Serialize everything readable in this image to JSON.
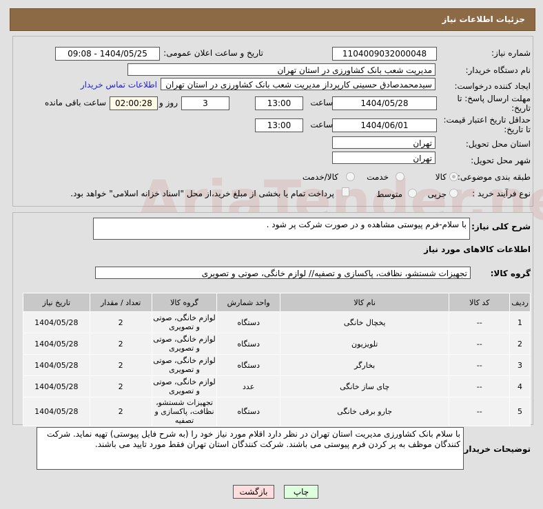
{
  "header": {
    "title": "جزئیات اطلاعات نیاز"
  },
  "form": {
    "need_number_label": "شماره نیاز:",
    "need_number": "1104009032000048",
    "announce_label": "تاریخ و ساعت اعلان عمومی:",
    "announce_value": "1404/05/25 - 09:08",
    "buyer_label": "نام دستگاه خریدار:",
    "buyer": "مدیریت شعب بانک کشاورزی در استان تهران",
    "creator_label": "ایجاد کننده درخواست:",
    "creator": "سیدمحمدصادق حسینی کارپرداز مدیریت شعب بانک کشاورزی در استان تهران",
    "contact_link": "اطلاعات تماس خریدار",
    "deadline_label": "مهلت ارسال پاسخ: تا تاریخ:",
    "deadline_date": "1404/05/28",
    "time_label": "ساعت",
    "deadline_time": "13:00",
    "days": "3",
    "days_label": "روز و",
    "remaining": "02:00:28",
    "remaining_label": "ساعت باقی مانده",
    "validity_label": "حداقل تاریخ اعتبار قیمت: تا تاریخ:",
    "validity_date": "1404/06/01",
    "validity_time": "13:00",
    "province_label": "استان محل تحویل:",
    "province": "تهران",
    "city_label": "شهر محل تحویل:",
    "city": "تهران",
    "category_label": "طبقه بندی موضوعی:",
    "category_options": [
      "کالا",
      "خدمت",
      "کالا/خدمت"
    ],
    "process_label": "نوع فرآیند خرید :",
    "process_options": [
      "جزیی",
      "متوسط"
    ],
    "payment_note": "پرداخت تمام یا بخشی از مبلغ خرید،از محل \"اسناد خزانه اسلامی\" خواهد بود."
  },
  "details": {
    "desc_label": "شرح کلی نیاز:",
    "desc": "با سلام-فرم پیوستی مشاهده و در صورت شرکت پر شود .",
    "goods_title": "اطلاعات کالاهای مورد نیاز",
    "group_label": "گروه کالا:",
    "group": "تجهیزات شستشو، نظافت، پاکسازی و تصفیه// لوازم خانگی، صوتی و تصویری",
    "columns": [
      "ردیف",
      "کد کالا",
      "نام کالا",
      "واحد شمارش",
      "گروه کالا",
      "تعداد / مقدار",
      "تاریخ نیاز"
    ],
    "rows": [
      [
        "1",
        "--",
        "یخچال خانگی",
        "دستگاه",
        "لوازم خانگی، صوتی و تصویری",
        "2",
        "1404/05/28"
      ],
      [
        "2",
        "--",
        "تلویزیون",
        "دستگاه",
        "لوازم خانگی، صوتی و تصویری",
        "2",
        "1404/05/28"
      ],
      [
        "3",
        "--",
        "بخارگر",
        "دستگاه",
        "لوازم خانگی، صوتی و تصویری",
        "2",
        "1404/05/28"
      ],
      [
        "4",
        "--",
        "چای ساز خانگی",
        "عدد",
        "لوازم خانگی، صوتی و تصویری",
        "2",
        "1404/05/28"
      ],
      [
        "5",
        "--",
        "جارو برقی خانگی",
        "دستگاه",
        "تجهیزات شستشو، نظافت، پاکسازی و تصفیه",
        "2",
        "1404/05/28"
      ]
    ],
    "buyer_notes_label": "توضیحات خریدار:",
    "buyer_notes": "با سلام بانک کشاورزی مدیریت استان تهران در نظر دارد اقلام مورد نیاز خود را (به شرح فایل پیوستی) تهیه نماید. شرکت کنندگان موظف به پر کردن فرم پیوستی می باشند. شرکت کنندگان استان تهران فقط مورد تایید می باشند."
  },
  "buttons": {
    "print": "چاپ",
    "back": "بازگشت"
  },
  "watermark": "AriaTender.net"
}
